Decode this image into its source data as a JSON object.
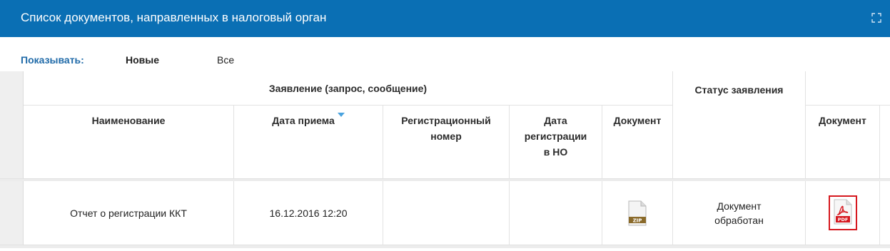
{
  "header": {
    "title": "Список документов, направленных в налоговый орган"
  },
  "filter": {
    "label": "Показывать:",
    "new": "Новые",
    "all": "Все"
  },
  "table": {
    "group_header": "Заявление (запрос, сообщение)",
    "status_header": "Статус заявления",
    "columns": {
      "name": "Наименование",
      "date_received": "Дата приема",
      "reg_number_line1": "Регистрационный",
      "reg_number_line2": "номер",
      "reg_date_line1": "Дата",
      "reg_date_line2": "регистрации",
      "reg_date_line3": "в НО",
      "document": "Документ",
      "status_document": "Документ"
    },
    "rows": [
      {
        "name": "Отчет о регистрации ККТ",
        "date_received": "16.12.2016 12:20",
        "reg_number": "",
        "reg_date": "",
        "doc_icon": "zip-file-icon",
        "doc_icon_label": "ZIP",
        "status_line1": "Документ",
        "status_line2": "обработан",
        "status_doc_icon": "pdf-file-icon",
        "status_doc_icon_label": "PDF"
      }
    ]
  },
  "colors": {
    "header_bg": "#0a6fb4",
    "accent_text": "#1f6aa8",
    "pdf_highlight": "#d6181f"
  }
}
